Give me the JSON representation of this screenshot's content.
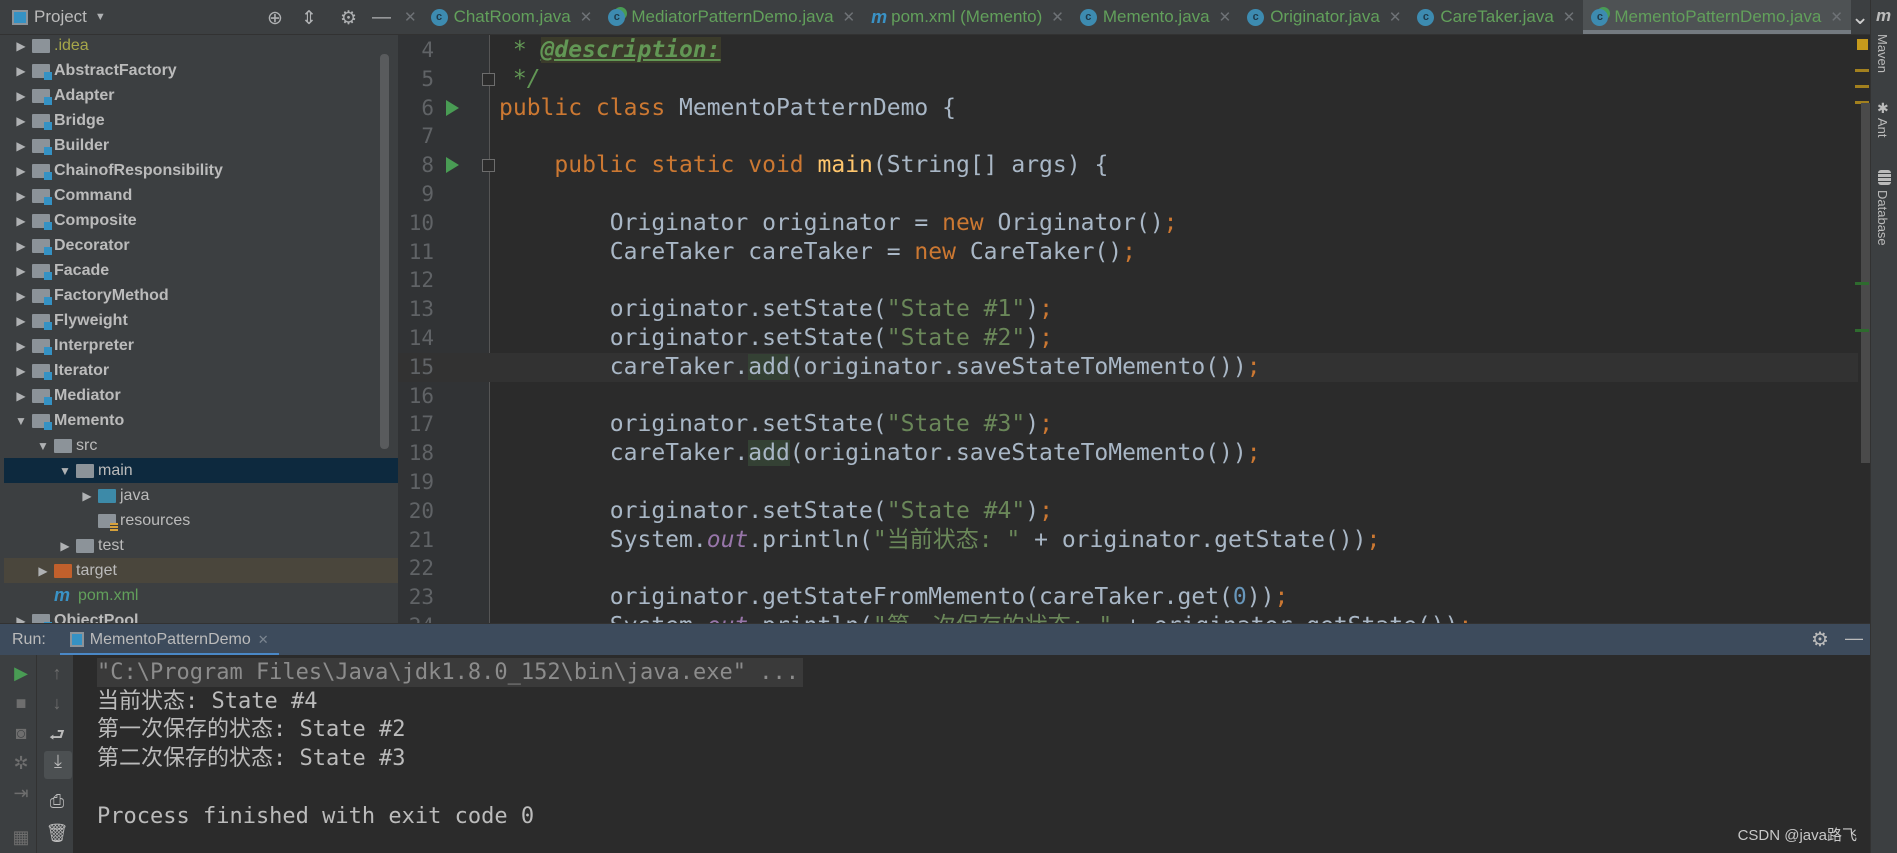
{
  "project": {
    "title": "Project",
    "dropdown_icon": "caret-down-icon",
    "tools": [
      "locate-icon",
      "collapse-all-icon",
      "gear-icon",
      "minimize-icon"
    ]
  },
  "tree": [
    {
      "label": ".idea",
      "depth": 0,
      "arrow": "collapsed",
      "icon": "folder",
      "color": "#a7a74a"
    },
    {
      "label": "AbstractFactory",
      "depth": 0,
      "arrow": "collapsed",
      "icon": "module",
      "bold": true
    },
    {
      "label": "Adapter",
      "depth": 0,
      "arrow": "collapsed",
      "icon": "module",
      "bold": true
    },
    {
      "label": "Bridge",
      "depth": 0,
      "arrow": "collapsed",
      "icon": "module",
      "bold": true
    },
    {
      "label": "Builder",
      "depth": 0,
      "arrow": "collapsed",
      "icon": "module",
      "bold": true
    },
    {
      "label": "ChainofResponsibility",
      "depth": 0,
      "arrow": "collapsed",
      "icon": "module",
      "bold": true
    },
    {
      "label": "Command",
      "depth": 0,
      "arrow": "collapsed",
      "icon": "module",
      "bold": true
    },
    {
      "label": "Composite",
      "depth": 0,
      "arrow": "collapsed",
      "icon": "module",
      "bold": true
    },
    {
      "label": "Decorator",
      "depth": 0,
      "arrow": "collapsed",
      "icon": "module",
      "bold": true
    },
    {
      "label": "Facade",
      "depth": 0,
      "arrow": "collapsed",
      "icon": "module",
      "bold": true
    },
    {
      "label": "FactoryMethod",
      "depth": 0,
      "arrow": "collapsed",
      "icon": "module",
      "bold": true
    },
    {
      "label": "Flyweight",
      "depth": 0,
      "arrow": "collapsed",
      "icon": "module",
      "bold": true
    },
    {
      "label": "Interpreter",
      "depth": 0,
      "arrow": "collapsed",
      "icon": "module",
      "bold": true
    },
    {
      "label": "Iterator",
      "depth": 0,
      "arrow": "collapsed",
      "icon": "module",
      "bold": true
    },
    {
      "label": "Mediator",
      "depth": 0,
      "arrow": "collapsed",
      "icon": "module",
      "bold": true
    },
    {
      "label": "Memento",
      "depth": 0,
      "arrow": "expanded",
      "icon": "module",
      "bold": true
    },
    {
      "label": "src",
      "depth": 1,
      "arrow": "expanded",
      "icon": "folder"
    },
    {
      "label": "main",
      "depth": 2,
      "arrow": "expanded",
      "icon": "folder",
      "selected": true
    },
    {
      "label": "java",
      "depth": 3,
      "arrow": "collapsed",
      "icon": "source-folder"
    },
    {
      "label": "resources",
      "depth": 3,
      "arrow": "none",
      "icon": "resources-folder"
    },
    {
      "label": "test",
      "depth": 2,
      "arrow": "collapsed",
      "icon": "folder"
    },
    {
      "label": "target",
      "depth": 1,
      "arrow": "collapsed",
      "icon": "excluded-folder",
      "excluded": true
    },
    {
      "label": "pom.xml",
      "depth": 1,
      "arrow": "none",
      "icon": "maven",
      "color": "#62a05b"
    },
    {
      "label": "ObjectPool",
      "depth": 0,
      "arrow": "collapsed",
      "icon": "module",
      "bold": true
    }
  ],
  "tabs": [
    {
      "label": "ChatRoom.java",
      "icon": "class"
    },
    {
      "label": "MediatorPatternDemo.java",
      "icon": "runnable-class"
    },
    {
      "label": "pom.xml (Memento)",
      "icon": "maven"
    },
    {
      "label": "Memento.java",
      "icon": "class"
    },
    {
      "label": "Originator.java",
      "icon": "class"
    },
    {
      "label": "CareTaker.java",
      "icon": "class"
    },
    {
      "label": "MementoPatternDemo.java",
      "icon": "runnable-class",
      "active": true
    }
  ],
  "editor": {
    "caret_line": "15",
    "lines": [
      {
        "n": "4",
        "t": [
          [
            " * ",
            "doc"
          ],
          [
            "@description:",
            "tag"
          ]
        ]
      },
      {
        "n": "5",
        "t": [
          [
            " */",
            "doc"
          ]
        ],
        "fold": true
      },
      {
        "n": "6",
        "run": true,
        "t": [
          [
            "public class ",
            "kw"
          ],
          [
            "MementoPatternDemo {",
            ""
          ]
        ]
      },
      {
        "n": "7",
        "t": []
      },
      {
        "n": "8",
        "run": true,
        "fold": true,
        "t": [
          [
            "    public static void ",
            "kw"
          ],
          [
            "main",
            "fn"
          ],
          [
            "(String[] args) {",
            ""
          ]
        ]
      },
      {
        "n": "9",
        "t": []
      },
      {
        "n": "10",
        "t": [
          [
            "        Originator originator = ",
            ""
          ],
          [
            "new ",
            "kw"
          ],
          [
            "Originator()",
            ""
          ],
          [
            ";",
            "kw"
          ]
        ]
      },
      {
        "n": "11",
        "t": [
          [
            "        CareTaker careTaker = ",
            ""
          ],
          [
            "new ",
            "kw"
          ],
          [
            "CareTaker()",
            ""
          ],
          [
            ";",
            "kw"
          ]
        ]
      },
      {
        "n": "12",
        "t": []
      },
      {
        "n": "13",
        "t": [
          [
            "        originator.setState(",
            ""
          ],
          [
            "\"State #1\"",
            "str"
          ],
          [
            ")",
            ""
          ],
          [
            ";",
            "kw"
          ]
        ]
      },
      {
        "n": "14",
        "t": [
          [
            "        originator.setState(",
            ""
          ],
          [
            "\"State #2\"",
            "str"
          ],
          [
            ")",
            ""
          ],
          [
            ";",
            "kw"
          ]
        ]
      },
      {
        "n": "15",
        "t": [
          [
            "        careTaker.",
            ""
          ],
          [
            "add",
            "use"
          ],
          [
            "(originator.saveStateToMemento())",
            ""
          ],
          [
            ";",
            "kw"
          ]
        ]
      },
      {
        "n": "16",
        "t": []
      },
      {
        "n": "17",
        "t": [
          [
            "        originator.setState(",
            ""
          ],
          [
            "\"State #3\"",
            "str"
          ],
          [
            ")",
            ""
          ],
          [
            ";",
            "kw"
          ]
        ]
      },
      {
        "n": "18",
        "t": [
          [
            "        careTaker.",
            ""
          ],
          [
            "add",
            "use"
          ],
          [
            "(originator.saveStateToMemento())",
            ""
          ],
          [
            ";",
            "kw"
          ]
        ]
      },
      {
        "n": "19",
        "t": []
      },
      {
        "n": "20",
        "t": [
          [
            "        originator.setState(",
            ""
          ],
          [
            "\"State #4\"",
            "str"
          ],
          [
            ")",
            ""
          ],
          [
            ";",
            "kw"
          ]
        ]
      },
      {
        "n": "21",
        "t": [
          [
            "        System.",
            ""
          ],
          [
            "out",
            "st"
          ],
          [
            ".println(",
            ""
          ],
          [
            "\"当前状态: \"",
            "str"
          ],
          [
            " + originator.getState())",
            ""
          ],
          [
            ";",
            "kw"
          ]
        ]
      },
      {
        "n": "22",
        "t": []
      },
      {
        "n": "23",
        "t": [
          [
            "        originator.getStateFromMemento(careTaker.get(",
            ""
          ],
          [
            "0",
            "num"
          ],
          [
            "))",
            ""
          ],
          [
            ";",
            "kw"
          ]
        ]
      },
      {
        "n": "24",
        "t": [
          [
            "        System.",
            ""
          ],
          [
            "out",
            "st"
          ],
          [
            ".println(",
            ""
          ],
          [
            "\"第一次保存的状态: \"",
            "str"
          ],
          [
            " + originator.getState())",
            ""
          ],
          [
            ";",
            "kw"
          ]
        ]
      }
    ]
  },
  "right_stripe": [
    {
      "label": "Maven",
      "icon": "maven-icon"
    },
    {
      "label": "Ant",
      "icon": "ant-icon"
    },
    {
      "label": "Database",
      "icon": "database-icon"
    }
  ],
  "run": {
    "label": "Run:",
    "config": "MementoPatternDemo",
    "output": [
      {
        "text": "\"C:\\Program Files\\Java\\jdk1.8.0_152\\bin\\java.exe\" ...",
        "cmd": true
      },
      {
        "text": "当前状态: State #4"
      },
      {
        "text": "第一次保存的状态: State #2"
      },
      {
        "text": "第二次保存的状态: State #3"
      },
      {
        "text": ""
      },
      {
        "text": "Process finished with exit code 0"
      }
    ]
  },
  "watermark": "CSDN @java路飞",
  "colors": {
    "keyword": "#cc7832",
    "string": "#6a8759",
    "number": "#6897bb",
    "method": "#ffc66d",
    "selection": "#0d293e",
    "run_green": "#499c54"
  }
}
